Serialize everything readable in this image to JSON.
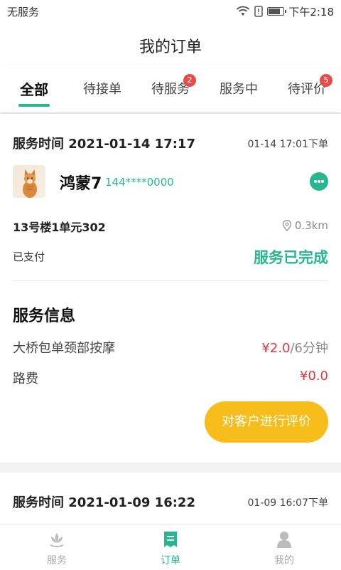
{
  "status_bar": {
    "carrier": "无服务",
    "time": "下午2:18",
    "battery_level": 0.8
  },
  "header": {
    "title": "我的订单"
  },
  "tabs": [
    {
      "label": "全部",
      "active": true,
      "badge": ""
    },
    {
      "label": "待接单",
      "active": false,
      "badge": ""
    },
    {
      "label": "待服务",
      "active": false,
      "badge": "2"
    },
    {
      "label": "服务中",
      "active": false,
      "badge": ""
    },
    {
      "label": "待评价",
      "active": false,
      "badge": "5"
    }
  ],
  "orders": [
    {
      "service_time": "服务时间 2021-01-14 17:17",
      "order_time": "01-14 17:01下单",
      "customer_name": "鸿蒙7",
      "customer_phone": "144****0000",
      "address": "13号楼1单元302",
      "distance": "0.3km",
      "payment_status": "已支付",
      "order_status": "服务已完成",
      "info_title": "服务信息",
      "item_name": "大桥包单颈部按摩",
      "item_price": "¥2.0",
      "item_duration": "/6分钟",
      "fee_label": "路费",
      "fee_value": "¥0.0",
      "action_label": "对客户进行评价"
    },
    {
      "service_time": "服务时间 2021-01-09 16:22",
      "order_time": "01-09 16:07下单"
    }
  ],
  "bottom_nav": [
    {
      "label": "服务",
      "icon": "lotus-icon",
      "active": false
    },
    {
      "label": "订单",
      "icon": "order-list-icon",
      "active": true
    },
    {
      "label": "我的",
      "icon": "person-icon",
      "active": false
    }
  ],
  "colors": {
    "accent": "#27b68f",
    "price_red": "#e0383e",
    "badge_red": "#e94b4b",
    "button_yellow": "#f7bd1b"
  }
}
